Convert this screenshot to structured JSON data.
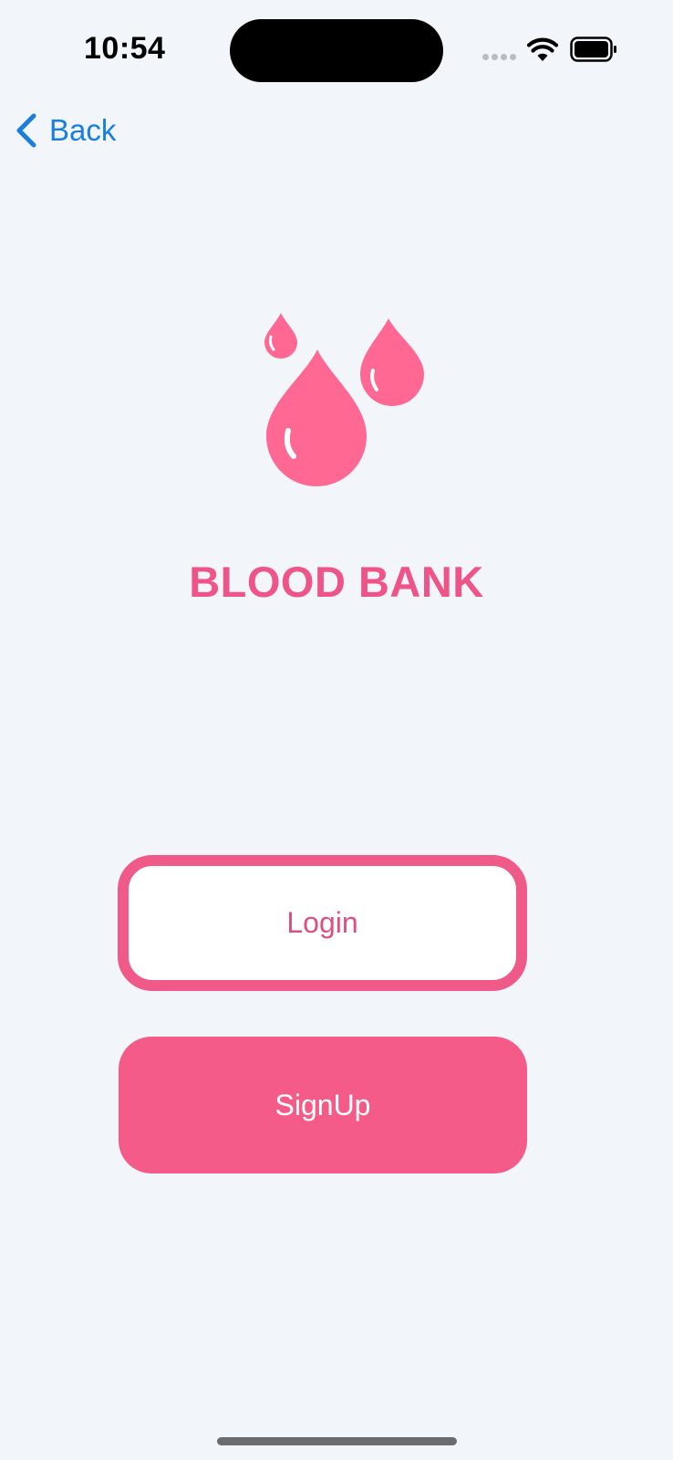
{
  "status_bar": {
    "time": "10:54"
  },
  "nav": {
    "back_label": "Back"
  },
  "app": {
    "title": "BLOOD BANK",
    "brand_color": "#f45b88"
  },
  "actions": {
    "login_label": "Login",
    "signup_label": "SignUp"
  },
  "icons": {
    "logo": "blood-drops-icon",
    "back": "chevron-left-icon",
    "wifi": "wifi-icon",
    "battery": "battery-icon"
  }
}
